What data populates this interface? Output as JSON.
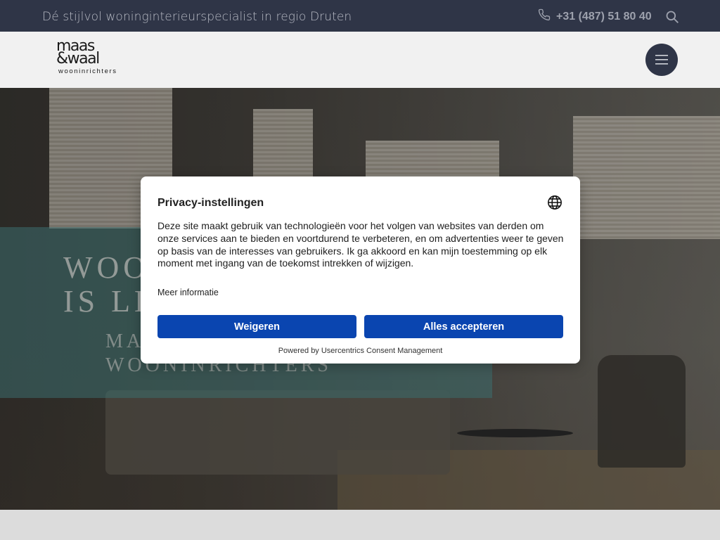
{
  "topbar": {
    "tagline": "Dé stijlvol woninginterieurspecialist in regio Druten",
    "phone": "+31 (487) 51 80 40",
    "phone_icon": "phone-icon",
    "search_icon": "search-icon"
  },
  "header": {
    "logo": {
      "line1": "maas",
      "line2": "&waal",
      "sub": "wooninrichters"
    },
    "menu_icon": "hamburger-menu-icon"
  },
  "hero": {
    "title_line1": "WOO",
    "title_line2": "IS LE",
    "sub_line1": "MA",
    "sub_line2": "WOONINRICHTERS"
  },
  "consent": {
    "title": "Privacy-instellingen",
    "language_icon": "globe-icon",
    "body": "Deze site maakt gebruik van technologieën voor het volgen van websites van derden om onze services aan te bieden en voortdurend te verbeteren, en om advertenties weer te geven op basis van de interesses van gebruikers. Ik ga akkoord en kan mijn toestemming op elk moment met ingang van de toekomst intrekken of wijzigen.",
    "more_info": "Meer informatie",
    "deny_label": "Weigeren",
    "accept_label": "Alles accepteren",
    "powered_by": "Powered by Usercentrics Consent Management"
  },
  "colors": {
    "topbar_bg": "#2f3547",
    "button_blue": "#0a45b0",
    "header_bg": "#f1f1f1"
  }
}
